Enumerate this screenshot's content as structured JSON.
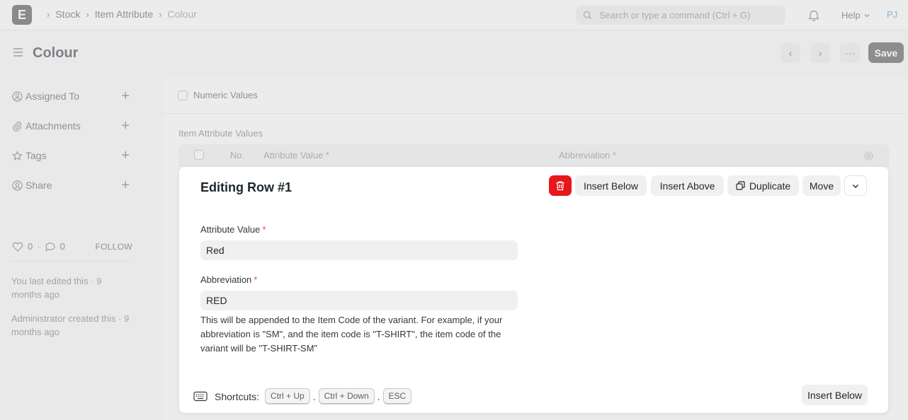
{
  "navbar": {
    "logo_letter": "E",
    "breadcrumbs": [
      "Stock",
      "Item Attribute",
      "Colour"
    ],
    "search_placeholder": "Search or type a command (Ctrl + G)",
    "help_label": "Help",
    "avatar_initials": "PJ"
  },
  "page": {
    "title": "Colour",
    "save_label": "Save",
    "more_label": "···"
  },
  "sidebar": {
    "items": [
      {
        "label": "Assigned To"
      },
      {
        "label": "Attachments"
      },
      {
        "label": "Tags"
      },
      {
        "label": "Share"
      }
    ],
    "likes_count": "0",
    "comments_count": "0",
    "follow_label": "FOLLOW",
    "last_edited": "You last edited this · 9 months ago",
    "created": "Administrator created this · 9 months ago"
  },
  "form": {
    "numeric_values_label": "Numeric Values",
    "table_label": "Item Attribute Values",
    "table_headers": {
      "no": "No.",
      "attribute_value": "Attribute Value *",
      "abbreviation": "Abbreviation *"
    }
  },
  "dialog": {
    "title": "Editing Row #1",
    "buttons": {
      "insert_below": "Insert Below",
      "insert_above": "Insert Above",
      "duplicate": "Duplicate",
      "move": "Move"
    },
    "fields": {
      "attribute_value_label": "Attribute Value",
      "attribute_value": "Red",
      "abbreviation_label": "Abbreviation",
      "abbreviation": "RED",
      "required_mark": "*"
    },
    "help_text": "This will be appended to the Item Code of the variant. For example, if your abbreviation is \"SM\", and the item code is \"T-SHIRT\", the item code of the variant will be \"T-SHIRT-SM\"",
    "shortcuts_label": "Shortcuts:",
    "shortcut_keys": [
      "Ctrl + Up",
      "Ctrl + Down",
      "ESC"
    ],
    "shortcut_separator": ".",
    "bottom_insert_below": "Insert Below"
  },
  "colors": {
    "delete_red": "#e7171b",
    "accent_blue": "#8fb1d8"
  }
}
